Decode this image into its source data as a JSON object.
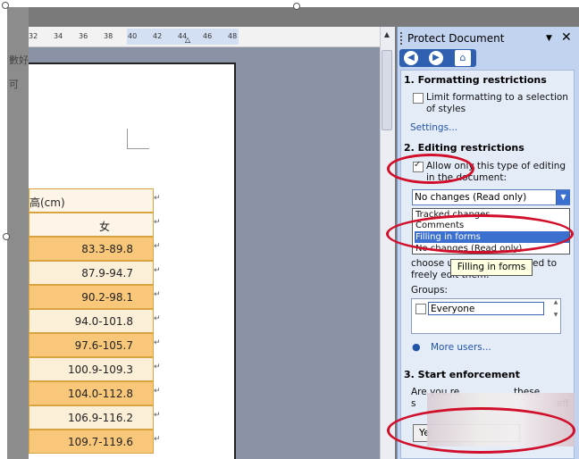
{
  "left_text": [
    "數好",
    "可"
  ],
  "ruler": {
    "ticks": [
      "32",
      "34",
      "36",
      "38",
      "40",
      "42",
      "44",
      "46",
      "48"
    ]
  },
  "table": {
    "header": "高(cm)",
    "subheader": "女",
    "rows": [
      "83.3-89.8",
      "87.9-94.7",
      "90.2-98.1",
      "94.0-101.8",
      "97.6-105.7",
      "100.9-109.3",
      "104.0-112.8",
      "106.9-116.2",
      "109.7-119.6"
    ]
  },
  "pane": {
    "title": "Protect Document",
    "formatting": {
      "heading": "1. Formatting restrictions",
      "checkbox_label": "Limit formatting to a selection of styles",
      "settings_link": "Settings..."
    },
    "editing": {
      "heading": "2. Editing restrictions",
      "checkbox_label": "Allow only this type of editing in the document:",
      "selected": "No changes (Read only)",
      "options": [
        "Tracked changes",
        "Comments",
        "Filling in forms",
        "No changes (Read only)"
      ],
      "highlighted_option": "Filling in forms",
      "tooltip": "Filling in forms",
      "hint_partial": "choose u",
      "hint_partial_right": "ed to",
      "hint_line2": "freely edit them.",
      "groups_label": "Groups:",
      "group_item": "Everyone",
      "more_users": "More users..."
    },
    "enforcement": {
      "heading": "3. Start enforcement",
      "text_start": "Are you re",
      "text_mid": "these",
      "text_line2_start": "s",
      "text_line2_end": "eff",
      "button_label": "Ye"
    }
  },
  "colors": {
    "accent": "#2e5fb0",
    "table_border": "#d9a440",
    "row_light": "#fcefd7",
    "row_dark": "#f9c77a",
    "annotation": "#d10f2a"
  }
}
